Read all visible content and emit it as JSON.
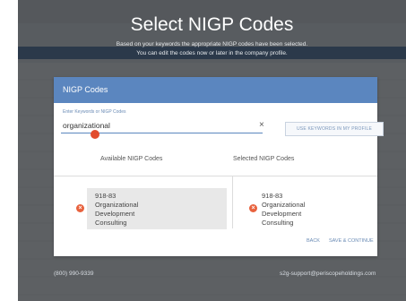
{
  "page": {
    "title": "Select NIGP Codes",
    "subtitle_line1": "Based on your keywords the appropriate NIGP codes have been selected.",
    "subtitle_line2": "You can edit the codes now or later in the company profile."
  },
  "modal": {
    "title": "NIGP Codes",
    "search": {
      "label": "Enter Keywords or NIGP Codes",
      "value": "organizational",
      "clear_symbol": "×"
    },
    "keywords_button": "USE KEYWORDS IN MY PROFILE",
    "available_header": "Available NIGP Codes",
    "selected_header": "Selected NIGP Codes",
    "available_codes": [
      {
        "code": "918-83",
        "name_line1": "Organizational",
        "name_line2": "Development",
        "name_line3": "Consulting"
      }
    ],
    "selected_codes": [
      {
        "code": "918-83",
        "name_line1": "Organizational",
        "name_line2": "Development",
        "name_line3": "Consulting"
      }
    ],
    "back_label": "BACK",
    "save_label": "SAVE & CONTINUE"
  },
  "footer": {
    "phone": "(800) 990-9339",
    "email": "s2g-support@periscopeholdings.com"
  },
  "colors": {
    "header_blue": "#5b86bf",
    "remove_red": "#e8623e"
  },
  "icons": {
    "clear": "close-icon",
    "remove": "remove-circle-icon"
  }
}
